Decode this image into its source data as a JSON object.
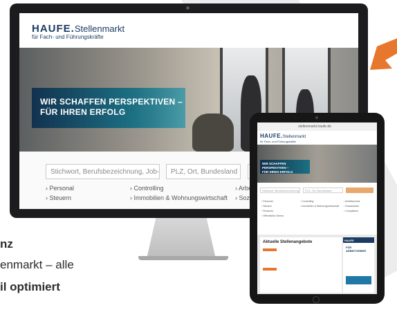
{
  "desktop": {
    "logo_brand": "HAUFE.",
    "logo_product": "Stellenmarkt",
    "logo_tagline": "für Fach- und Führungskräfte",
    "banner_line1": "WIR SCHAFFEN PERSPEKTIVEN –",
    "banner_line2": "FÜR IHREN ERFOLG",
    "search_keyword_placeholder": "Stichwort, Berufsbezeichnung, Job-ID",
    "search_location_placeholder": "PLZ, Ort, Bundesland",
    "categories": [
      "› Personal",
      "› Steuern",
      "› Controlling",
      "› Immobilien & Wohnungswirtschaft",
      "› Arbeitsschu",
      "› Sozialwese"
    ]
  },
  "tablet": {
    "url": "stellenmarkt.haufe.de",
    "logo_brand": "HAUFE.",
    "logo_product": "Stellenmarkt",
    "logo_tagline": "für Fach- und Führungskräfte",
    "banner_line1": "WIR SCHAFFEN PERSPEKTIVEN –",
    "banner_line2": "FÜR IHREN ERFOLG",
    "search_keyword_placeholder": "Stichwort, Berufsbezeichnung",
    "search_location_placeholder": "PLZ, Ort, Bundesland",
    "categories": [
      "› Personal",
      "› Steuern",
      "› Finanzen",
      "› Öffentlicher Dienst",
      "› Controlling",
      "› Immobilien & Wohnungswirtschaft",
      "› Arbeitsschutz",
      "› Sozialwesen",
      "› Compliance"
    ],
    "jobs_title": "Aktuelle Stellenangebote",
    "sidebar_header": "HAUFE",
    "sidebar_text": [
      "FÜR",
      "ARBEITGEBER"
    ]
  },
  "side_text": {
    "line1": "nz",
    "line2": "enmarkt – alle",
    "line3": "il optimiert"
  },
  "colors": {
    "brand_navy": "#1b3b62",
    "banner_teal": "#1c6f82",
    "arrow_orange": "#e8772e",
    "device_black": "#1c1c1e"
  }
}
